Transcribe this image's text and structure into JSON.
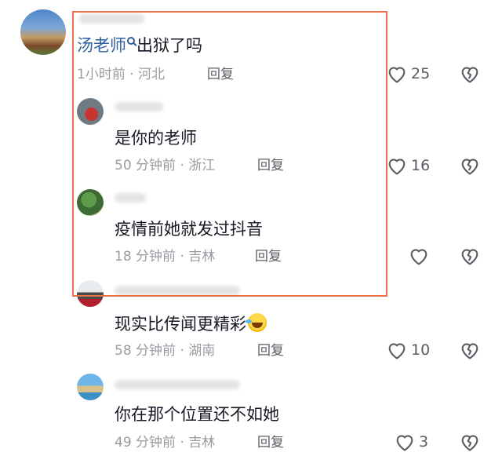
{
  "comments": [
    {
      "mention": "汤老师",
      "text": "出狱了吗",
      "time": "1小时前",
      "location": "河北",
      "reply": "回复",
      "likes": "25"
    },
    {
      "text": "是你的老师",
      "time": "50 分钟前",
      "location": "浙江",
      "reply": "回复",
      "likes": "16"
    },
    {
      "text": "疫情前她就发过抖音",
      "time": "18 分钟前",
      "location": "吉林",
      "reply": "回复",
      "likes": ""
    },
    {
      "text": "现实比传闻更精彩",
      "time": "58 分钟前",
      "location": "湖南",
      "reply": "回复",
      "likes": "10"
    },
    {
      "text": "你在那个位置还不如她",
      "time": "49 分钟前",
      "location": "吉林",
      "reply": "回复",
      "likes": "3"
    }
  ],
  "separator": " · ",
  "icons": {
    "like": "heart-outline-icon",
    "dislike": "broken-heart-icon",
    "mention_search": "search-icon",
    "emoji": "laughing-crying-emoji-icon"
  },
  "colors": {
    "highlight": "#e8714a",
    "mention": "#2f5f9e",
    "meta": "#9a9ba1"
  }
}
